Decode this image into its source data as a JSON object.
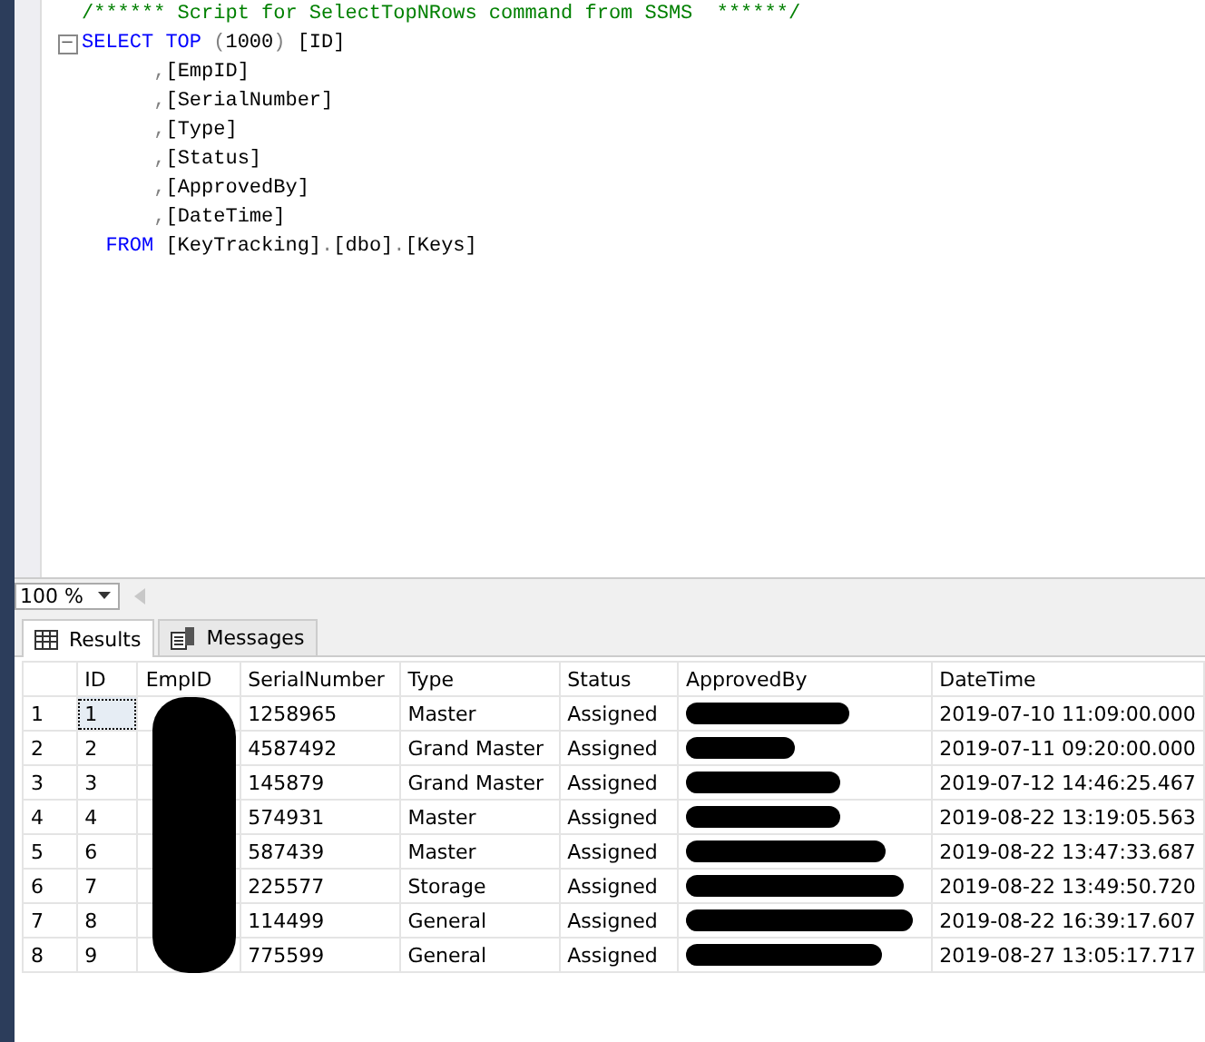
{
  "editor": {
    "collapse_glyph": "−",
    "lines": [
      [
        {
          "kind": "comment",
          "text": "/****** Script for SelectTopNRows command from SSMS  ******/"
        }
      ],
      [
        {
          "kind": "keyword",
          "text": "SELECT"
        },
        {
          "kind": "keyword",
          "text": " TOP"
        },
        {
          "kind": "punct",
          "text": " ("
        },
        {
          "kind": "plain",
          "text": "1000"
        },
        {
          "kind": "punct",
          "text": ")"
        },
        {
          "kind": "plain",
          "text": " [ID]"
        }
      ],
      [
        {
          "kind": "punct",
          "text": "      ,"
        },
        {
          "kind": "plain",
          "text": "[EmpID]"
        }
      ],
      [
        {
          "kind": "punct",
          "text": "      ,"
        },
        {
          "kind": "plain",
          "text": "[SerialNumber]"
        }
      ],
      [
        {
          "kind": "punct",
          "text": "      ,"
        },
        {
          "kind": "plain",
          "text": "[Type]"
        }
      ],
      [
        {
          "kind": "punct",
          "text": "      ,"
        },
        {
          "kind": "plain",
          "text": "[Status]"
        }
      ],
      [
        {
          "kind": "punct",
          "text": "      ,"
        },
        {
          "kind": "plain",
          "text": "[ApprovedBy]"
        }
      ],
      [
        {
          "kind": "punct",
          "text": "      ,"
        },
        {
          "kind": "plain",
          "text": "[DateTime]"
        }
      ],
      [
        {
          "kind": "keyword",
          "text": "  FROM"
        },
        {
          "kind": "plain",
          "text": " [KeyTracking]"
        },
        {
          "kind": "punct",
          "text": "."
        },
        {
          "kind": "plain",
          "text": "[dbo]"
        },
        {
          "kind": "punct",
          "text": "."
        },
        {
          "kind": "plain",
          "text": "[Keys]"
        }
      ]
    ]
  },
  "zoom": {
    "value": "100 %"
  },
  "tabs": [
    {
      "label": "Results",
      "kind": "grid",
      "selected": true
    },
    {
      "label": "Messages",
      "kind": "doc",
      "selected": false
    }
  ],
  "table": {
    "columns": [
      "ID",
      "EmpID",
      "SerialNumber",
      "Type",
      "Status",
      "ApprovedBy",
      "DateTime"
    ],
    "rows": [
      {
        "row": "1",
        "selected": true,
        "cells": [
          "1",
          "",
          "1258965",
          "Master",
          "Assigned",
          "",
          "2019-07-10 11:09:00.000"
        ]
      },
      {
        "row": "2",
        "selected": false,
        "cells": [
          "2",
          "",
          "4587492",
          "Grand Master",
          "Assigned",
          "",
          "2019-07-11 09:20:00.000"
        ]
      },
      {
        "row": "3",
        "selected": false,
        "cells": [
          "3",
          "",
          "145879",
          "Grand Master",
          "Assigned",
          "",
          "2019-07-12 14:46:25.467"
        ]
      },
      {
        "row": "4",
        "selected": false,
        "cells": [
          "4",
          "",
          "574931",
          "Master",
          "Assigned",
          "",
          "2019-08-22 13:19:05.563"
        ]
      },
      {
        "row": "5",
        "selected": false,
        "cells": [
          "6",
          "",
          "587439",
          "Master",
          "Assigned",
          "",
          "2019-08-22 13:47:33.687"
        ]
      },
      {
        "row": "6",
        "selected": false,
        "cells": [
          "7",
          "",
          "225577",
          "Storage",
          "Assigned",
          "",
          "2019-08-22 13:49:50.720"
        ]
      },
      {
        "row": "7",
        "selected": false,
        "cells": [
          "8",
          "",
          "114499",
          "General",
          "Assigned",
          "",
          "2019-08-22 16:39:17.607"
        ]
      },
      {
        "row": "8",
        "selected": false,
        "cells": [
          "9",
          "",
          "775599",
          "General",
          "Assigned",
          "",
          "2019-08-27 13:05:17.717"
        ]
      }
    ]
  }
}
